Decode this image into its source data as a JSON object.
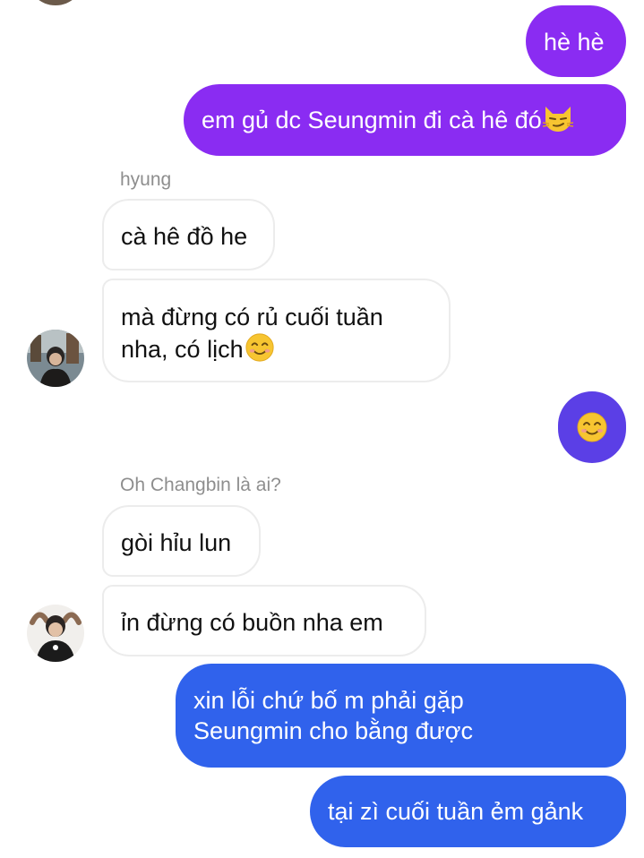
{
  "colors": {
    "purple": "#8a2cf2",
    "violet": "#6b3ee8",
    "indigo": "#5b3fe6",
    "blue": "#3062ec",
    "incoming_bg": "#ffffff",
    "incoming_border": "#ececec",
    "sender_name": "#8e8e8e",
    "emoji_yellow": "#f7c531"
  },
  "messages": {
    "m1": "hè hè",
    "m2": "em gủ dc Seungmin đi cà hê đó",
    "m2_emoji": "smirk-cat-icon",
    "sender1": "hyung",
    "m3": "cà hê đồ he",
    "m4_line1": "mà đừng có rủ cuối tuần",
    "m4_line2": "nha, có lịch",
    "m4_emoji": "smiling-face-icon",
    "m5_emoji": "smiling-face-icon",
    "sender2": "Oh Changbin là ai?",
    "m6": "gòi hỉu lun",
    "m7": "ỉn đừng có buồn nha em",
    "m8_line1": "xin lỗi chứ bố m phải gặp",
    "m8_line2": "Seungmin cho bằng được",
    "m9": "tại zì cuối tuần ẻm gảnk"
  }
}
